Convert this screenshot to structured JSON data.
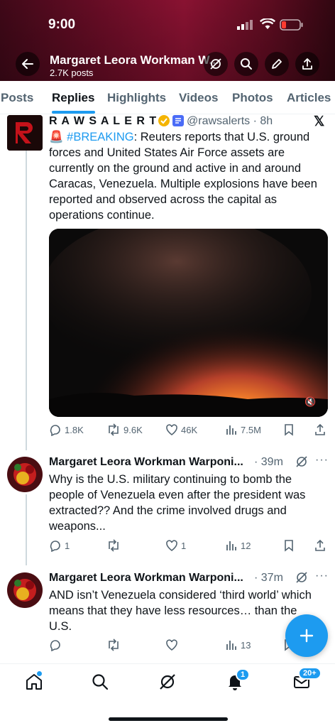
{
  "status_bar": {
    "time": "9:00"
  },
  "header": {
    "title": "Margaret Leora Workman W...",
    "subtitle": "2.7K posts"
  },
  "tabs": [
    "Posts",
    "Replies",
    "Highlights",
    "Videos",
    "Photos",
    "Articles"
  ],
  "active_tab": "Replies",
  "posts": [
    {
      "name": "R A W S A L E R T S",
      "handle": "@rawsalerts · 8h",
      "alert_emoji": "🚨",
      "hashtag": "#BREAKING",
      "text": ": Reuters reports that U.S. ground forces and United States Air Force assets are currently on the ground and active in and around Caracas, Venezuela. Multiple explosions have been reported and observed across the capital as operations continue.",
      "replies": "1.8K",
      "reposts": "9.6K",
      "likes": "46K",
      "views": "7.5M"
    },
    {
      "name": "Margaret Leora Workman Warponi...",
      "time": "· 39m",
      "text": "Why is the U.S. military continuing to bomb the people of Venezuela even after the president was extracted?? And the crime involved drugs and weapons...",
      "replies": "1",
      "reposts": "",
      "likes": "1",
      "views": "12"
    },
    {
      "name": "Margaret Leora Workman Warponi...",
      "time": "· 37m",
      "text": "AND isn’t Venezuela considered ‘third world’ which means that they have less resources… than the U.S.",
      "replies": "",
      "reposts": "",
      "likes": "",
      "views": "13"
    }
  ],
  "nav": {
    "notifications_badge": "1",
    "messages_badge": "20+"
  },
  "colors": {
    "accent": "#1d9bf0",
    "verified_gold": "#f4b400",
    "text": "#0f1419",
    "muted": "#536471"
  }
}
